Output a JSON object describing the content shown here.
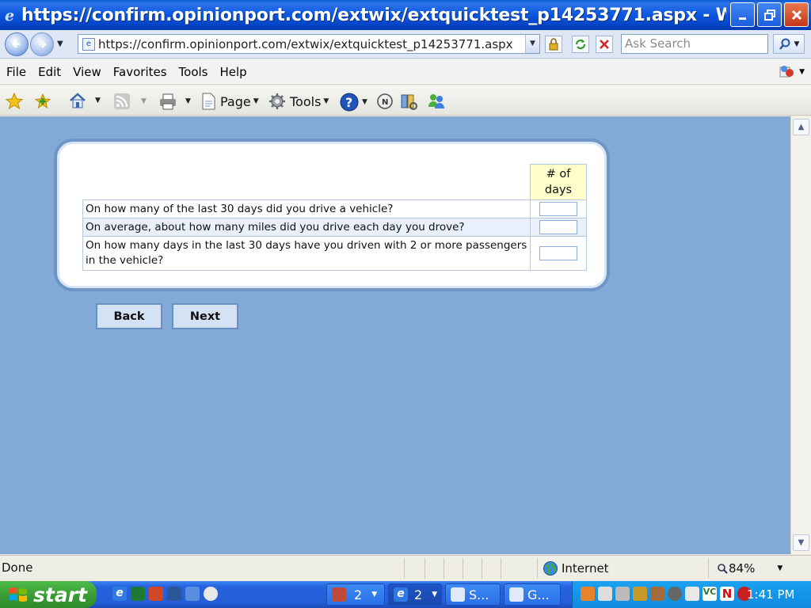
{
  "window": {
    "title": "https://confirm.opinionport.com/extwix/extquicktest_p14253771.aspx - Wi..."
  },
  "address_bar": {
    "url": "https://confirm.opinionport.com/extwix/extquicktest_p14253771.aspx",
    "search_placeholder": "Ask Search"
  },
  "menu": [
    "File",
    "Edit",
    "View",
    "Favorites",
    "Tools",
    "Help"
  ],
  "command_bar": {
    "page_label": "Page",
    "tools_label": "Tools"
  },
  "survey": {
    "column_header": "# of days",
    "questions": [
      {
        "text": "On how many of the last 30 days did you drive a vehicle?",
        "answer": ""
      },
      {
        "text": "On average, about how many miles did you drive each day you drove?",
        "answer": ""
      },
      {
        "text": "On how many days in the last 30 days have you driven with 2 or more passengers in the vehicle?",
        "answer": ""
      }
    ],
    "back_label": "Back",
    "next_label": "Next"
  },
  "status_bar": {
    "status": "Done",
    "zone": "Internet",
    "zoom": "84%"
  },
  "taskbar": {
    "start_label": "start",
    "buttons": [
      {
        "label": "2"
      },
      {
        "label": "2"
      },
      {
        "label": "S..."
      },
      {
        "label": "G..."
      }
    ],
    "clock": "1:41 PM"
  }
}
